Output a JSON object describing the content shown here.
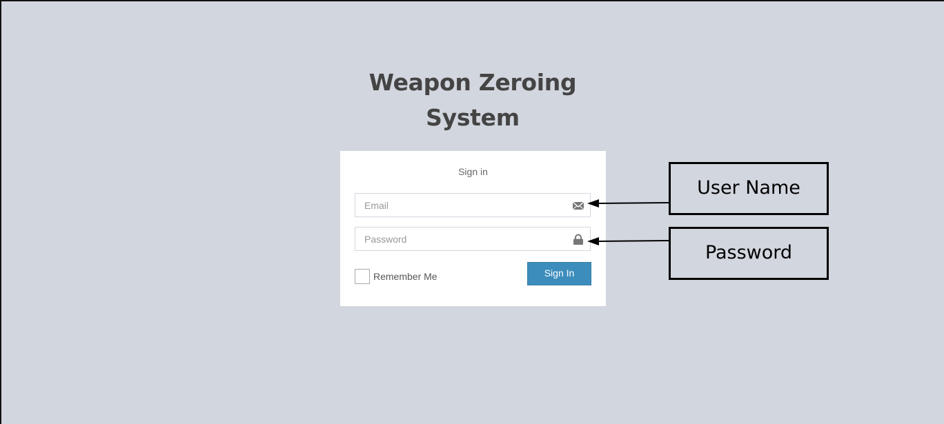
{
  "app_title_line1": "Weapon Zeroing",
  "app_title_line2": "System",
  "login": {
    "message": "Sign in",
    "email": {
      "value": "",
      "placeholder": "Email",
      "icon": "envelope-icon"
    },
    "password": {
      "value": "",
      "placeholder": "Password",
      "icon": "lock-icon"
    },
    "remember_label": "Remember Me",
    "remember_checked": false,
    "submit_label": "Sign In"
  },
  "annotations": {
    "user_name": "User Name",
    "password": "Password"
  },
  "colors": {
    "background": "#d2d6de",
    "primary_button": "#3c8dbc",
    "title_text": "#444444"
  }
}
